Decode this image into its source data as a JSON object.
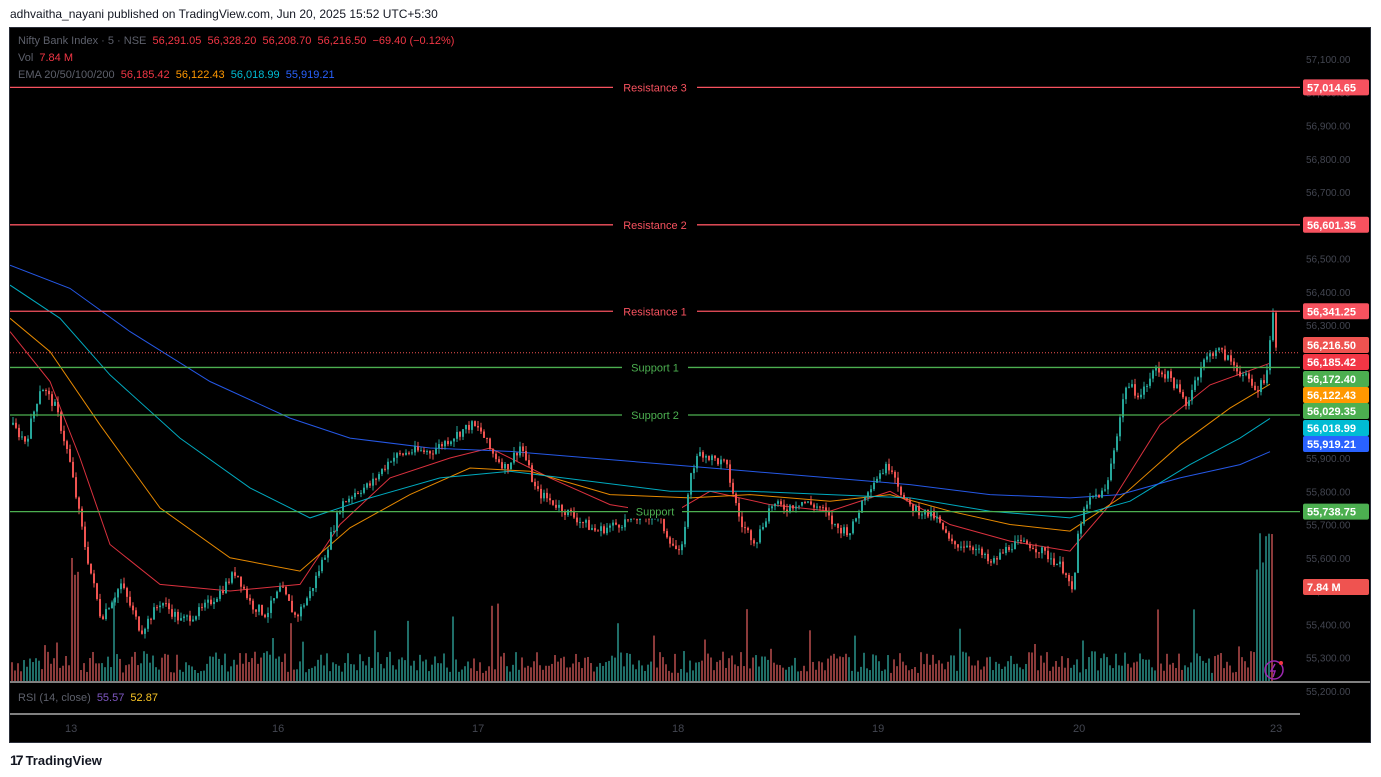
{
  "publisher": "adhvaitha_nayani published on TradingView.com, Jun 20, 2025 15:52 UTC+5:30",
  "brand": "TradingView",
  "legend": {
    "symbol": "Nifty Bank Index · 5 · NSE",
    "ohlc": [
      "56,291.05",
      "56,328.20",
      "56,208.70",
      "56,216.50"
    ],
    "change": "−69.40 (−0.12%)",
    "vol_label": "Vol",
    "vol_value": "7.84 M",
    "ema_label": "EMA 20/50/100/200",
    "ema_values": [
      "56,185.42",
      "56,122.43",
      "56,018.99",
      "55,919.21"
    ],
    "rsi_label": "RSI (14, close)",
    "rsi_values": [
      "55.57",
      "52.87"
    ]
  },
  "colors": {
    "up": "#26a69a",
    "down": "#ef5350",
    "resistance": "#f7525f",
    "support": "#4caf50",
    "ema20": "#f23645",
    "ema50": "#ff9800",
    "ema100": "#00bcd4",
    "ema200": "#2962ff"
  },
  "chart_data": {
    "type": "candlestick",
    "y_axis_ticks": [
      "57,100.00",
      "57,000.00",
      "56,900.00",
      "56,800.00",
      "56,700.00",
      "56,600.00",
      "56,500.00",
      "56,400.00",
      "56,300.00",
      "56,200.00",
      "56,100.00",
      "56,000.00",
      "55,900.00",
      "55,800.00",
      "55,700.00",
      "55,600.00",
      "55,500.00",
      "55,400.00",
      "55,300.00",
      "55,200.00"
    ],
    "ylim": [
      55200,
      57150
    ],
    "x_axis_labels": [
      "13",
      "16",
      "17",
      "18",
      "19",
      "20",
      "23"
    ],
    "levels": [
      {
        "label": "Resistance 3",
        "value": 57014.65,
        "tag": "57,014.65",
        "kind": "resistance"
      },
      {
        "label": "Resistance 2",
        "value": 56601.35,
        "tag": "56,601.35",
        "kind": "resistance"
      },
      {
        "label": "Resistance 1",
        "value": 56341.25,
        "tag": "56,341.25",
        "kind": "resistance"
      },
      {
        "label": "Support 1",
        "value": 56172.4,
        "tag": "56,172.40",
        "kind": "support"
      },
      {
        "label": "Support 2",
        "value": 56029.35,
        "tag": "56,029.35",
        "kind": "support"
      },
      {
        "label": "Support",
        "value": 55738.75,
        "tag": "55,738.75",
        "kind": "support"
      }
    ],
    "last_price": {
      "value": 56216.5,
      "tag": "56,216.50"
    },
    "ema_tags": [
      {
        "value": 56185.42,
        "tag": "56,185.42",
        "color": "#f23645"
      },
      {
        "value": 56122.43,
        "tag": "56,122.43",
        "color": "#ff9800"
      },
      {
        "value": 56018.99,
        "tag": "56,018.99",
        "color": "#00bcd4"
      },
      {
        "value": 55919.21,
        "tag": "55,919.21",
        "color": "#2962ff"
      }
    ],
    "volume_tag": "7.84 M",
    "price_path": [
      [
        0,
        56000
      ],
      [
        15,
        55950
      ],
      [
        30,
        56120
      ],
      [
        45,
        56050
      ],
      [
        58,
        55900
      ],
      [
        75,
        55620
      ],
      [
        90,
        55420
      ],
      [
        110,
        55520
      ],
      [
        130,
        55380
      ],
      [
        150,
        55470
      ],
      [
        170,
        55410
      ],
      [
        190,
        55440
      ],
      [
        210,
        55500
      ],
      [
        225,
        55560
      ],
      [
        240,
        55460
      ],
      [
        255,
        55430
      ],
      [
        270,
        55510
      ],
      [
        285,
        55420
      ],
      [
        300,
        55500
      ],
      [
        315,
        55620
      ],
      [
        330,
        55760
      ],
      [
        345,
        55800
      ],
      [
        360,
        55820
      ],
      [
        380,
        55900
      ],
      [
        400,
        55920
      ],
      [
        420,
        55920
      ],
      [
        440,
        55960
      ],
      [
        460,
        56000
      ],
      [
        470,
        55980
      ],
      [
        480,
        55920
      ],
      [
        495,
        55870
      ],
      [
        510,
        55940
      ],
      [
        525,
        55800
      ],
      [
        545,
        55760
      ],
      [
        565,
        55720
      ],
      [
        585,
        55680
      ],
      [
        605,
        55700
      ],
      [
        625,
        55720
      ],
      [
        645,
        55730
      ],
      [
        660,
        55650
      ],
      [
        670,
        55600
      ],
      [
        680,
        55860
      ],
      [
        690,
        55920
      ],
      [
        700,
        55900
      ],
      [
        715,
        55880
      ],
      [
        730,
        55700
      ],
      [
        745,
        55650
      ],
      [
        760,
        55760
      ],
      [
        775,
        55750
      ],
      [
        790,
        55770
      ],
      [
        810,
        55750
      ],
      [
        825,
        55690
      ],
      [
        840,
        55680
      ],
      [
        855,
        55800
      ],
      [
        870,
        55860
      ],
      [
        880,
        55880
      ],
      [
        895,
        55760
      ],
      [
        910,
        55740
      ],
      [
        925,
        55720
      ],
      [
        940,
        55640
      ],
      [
        960,
        55640
      ],
      [
        980,
        55580
      ],
      [
        1000,
        55640
      ],
      [
        1020,
        55640
      ],
      [
        1040,
        55600
      ],
      [
        1055,
        55560
      ],
      [
        1062,
        55480
      ],
      [
        1068,
        55700
      ],
      [
        1080,
        55780
      ],
      [
        1095,
        55800
      ],
      [
        1105,
        55960
      ],
      [
        1115,
        56120
      ],
      [
        1130,
        56090
      ],
      [
        1145,
        56170
      ],
      [
        1160,
        56140
      ],
      [
        1175,
        56060
      ],
      [
        1190,
        56180
      ],
      [
        1205,
        56230
      ],
      [
        1220,
        56190
      ],
      [
        1235,
        56140
      ],
      [
        1245,
        56100
      ],
      [
        1255,
        56150
      ],
      [
        1262,
        56330
      ],
      [
        1266,
        56216
      ]
    ],
    "ema_paths": [
      [
        [
          0,
          56280
        ],
        [
          40,
          56130
        ],
        [
          70,
          55900
        ],
        [
          100,
          55640
        ],
        [
          150,
          55520
        ],
        [
          220,
          55500
        ],
        [
          290,
          55520
        ],
        [
          330,
          55700
        ],
        [
          380,
          55840
        ],
        [
          440,
          55900
        ],
        [
          480,
          55930
        ],
        [
          540,
          55840
        ],
        [
          600,
          55760
        ],
        [
          660,
          55730
        ],
        [
          700,
          55800
        ],
        [
          760,
          55760
        ],
        [
          820,
          55740
        ],
        [
          880,
          55800
        ],
        [
          940,
          55700
        ],
        [
          1000,
          55650
        ],
        [
          1060,
          55620
        ],
        [
          1100,
          55760
        ],
        [
          1150,
          56000
        ],
        [
          1200,
          56120
        ],
        [
          1260,
          56185
        ]
      ],
      [
        [
          0,
          56320
        ],
        [
          40,
          56220
        ],
        [
          90,
          56000
        ],
        [
          150,
          55750
        ],
        [
          220,
          55600
        ],
        [
          290,
          55560
        ],
        [
          340,
          55690
        ],
        [
          400,
          55790
        ],
        [
          460,
          55870
        ],
        [
          520,
          55860
        ],
        [
          600,
          55790
        ],
        [
          680,
          55780
        ],
        [
          740,
          55790
        ],
        [
          820,
          55770
        ],
        [
          880,
          55790
        ],
        [
          940,
          55740
        ],
        [
          1000,
          55700
        ],
        [
          1060,
          55680
        ],
        [
          1110,
          55780
        ],
        [
          1170,
          55940
        ],
        [
          1220,
          56050
        ],
        [
          1260,
          56122
        ]
      ],
      [
        [
          0,
          56420
        ],
        [
          50,
          56320
        ],
        [
          100,
          56150
        ],
        [
          170,
          55960
        ],
        [
          240,
          55810
        ],
        [
          300,
          55720
        ],
        [
          360,
          55780
        ],
        [
          430,
          55840
        ],
        [
          500,
          55860
        ],
        [
          580,
          55830
        ],
        [
          660,
          55800
        ],
        [
          740,
          55800
        ],
        [
          820,
          55790
        ],
        [
          900,
          55780
        ],
        [
          980,
          55740
        ],
        [
          1060,
          55720
        ],
        [
          1120,
          55770
        ],
        [
          1180,
          55880
        ],
        [
          1230,
          55960
        ],
        [
          1260,
          56019
        ]
      ],
      [
        [
          0,
          56480
        ],
        [
          60,
          56410
        ],
        [
          120,
          56280
        ],
        [
          200,
          56130
        ],
        [
          280,
          56020
        ],
        [
          340,
          55960
        ],
        [
          420,
          55930
        ],
        [
          500,
          55920
        ],
        [
          580,
          55900
        ],
        [
          660,
          55880
        ],
        [
          740,
          55860
        ],
        [
          820,
          55840
        ],
        [
          900,
          55820
        ],
        [
          980,
          55790
        ],
        [
          1060,
          55780
        ],
        [
          1110,
          55790
        ],
        [
          1170,
          55840
        ],
        [
          1230,
          55880
        ],
        [
          1260,
          55919
        ]
      ]
    ]
  }
}
